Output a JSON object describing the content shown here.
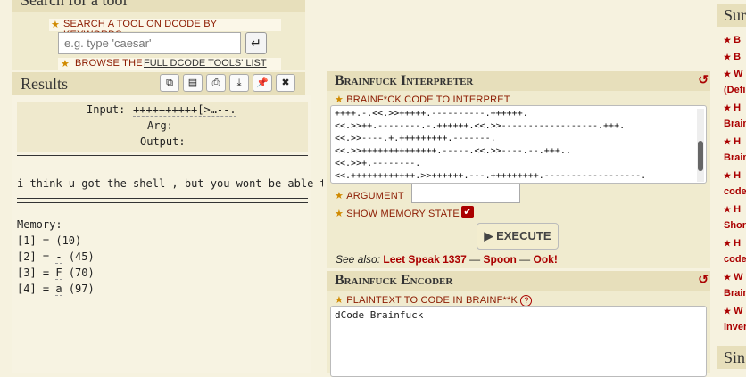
{
  "search": {
    "title": "Search for a tool",
    "keywords_label": "SEARCH A TOOL ON DCODE BY KEYWORDS:",
    "placeholder": "e.g. type 'caesar'",
    "go_icon": "enter-icon",
    "browse_prefix": "BROWSE THE",
    "browse_link": "FULL DCODE TOOLS' LIST"
  },
  "results": {
    "title": "Results",
    "toolbar_icons": [
      "copy-icon",
      "copy-all-icon",
      "print-icon",
      "download-icon",
      "pin-icon",
      "close-icon"
    ],
    "input_label": "Input:",
    "input_value": "++++++++++[>…--.",
    "arg_label": "Arg:",
    "output_label": "Output:",
    "output_text": "i think u got the shell , but you wont be able to kill me -kira",
    "memory_label": "Memory:",
    "memory": [
      {
        "index": "[1] =",
        "char": " ",
        "code": "(10)"
      },
      {
        "index": "[2] =",
        "char": "-",
        "code": "(45)"
      },
      {
        "index": "[3] =",
        "char": "F",
        "code": "(70)"
      },
      {
        "index": "[4] =",
        "char": "a",
        "code": "(97)"
      }
    ]
  },
  "interpreter": {
    "title": "Brainfuck Interpreter",
    "reset_icon": "reset-icon",
    "code_label": "BRAINF*CK CODE TO INTERPRET",
    "code_lines": [
      "++++.-.<<.>>+++++.----------.++++++.",
      "<<.>>++.--------.-.++++++.<<.>>------------------.+++.",
      "<<.>>----.+.+++++++++.-------.",
      "<<.>>++++++++++++++.-----.<<.>>----.--.+++..",
      "<<.>>+.--------.",
      "<<.++++++++++++.>>++++++.---.+++++++++.------------------."
    ],
    "argument_label": "ARGUMENT",
    "memory_state_label": "SHOW MEMORY STATE",
    "execute_label": "▶ EXECUTE",
    "see_also_label": "See also:",
    "see_also_links": [
      "Leet Speak 1337",
      "Spoon",
      "Ook!"
    ],
    "see_also_sep": "—"
  },
  "encoder": {
    "title": "Brainfuck Encoder",
    "reset_icon": "reset-icon",
    "plaintext_label": "PLAINTEXT TO CODE IN BRAINF**K",
    "help_icon": "help-icon",
    "plaintext_value": "dCode Brainfuck"
  },
  "sidebar": {
    "title1": "Sur",
    "items": [
      {
        "text": "B"
      },
      {
        "text": "B"
      },
      {
        "text": "W"
      },
      {
        "text": "(Defi"
      },
      {
        "text": "H"
      },
      {
        "text": "Brain"
      },
      {
        "text": "H"
      },
      {
        "text": "Brain"
      },
      {
        "text": "H"
      },
      {
        "text": "code"
      },
      {
        "text": "H"
      },
      {
        "text": "Shor"
      },
      {
        "text": "H"
      },
      {
        "text": "code"
      },
      {
        "text": "W"
      },
      {
        "text": "Brain"
      },
      {
        "text": "W"
      },
      {
        "text": "inver"
      }
    ],
    "title2": "Sin"
  }
}
